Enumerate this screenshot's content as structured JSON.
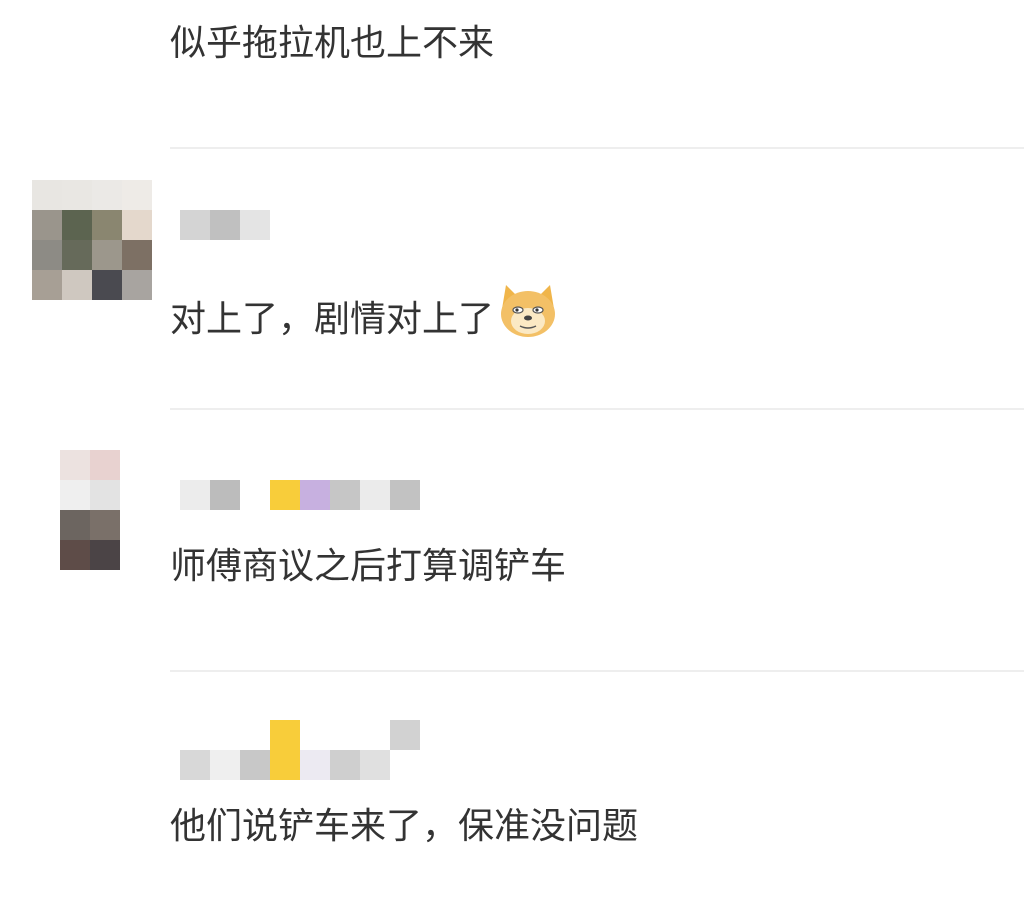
{
  "comments": [
    {
      "text": "似乎拖拉机也上不来"
    },
    {
      "text": "对上了，剧情对上了",
      "emoji": "doge-emoji"
    },
    {
      "text": "师傅商议之后打算调铲车"
    },
    {
      "text": "他们说铲车来了，保准没问题"
    }
  ],
  "colors": {
    "text": "#333333",
    "divider": "#eeeeee",
    "blur_yellow": "#f8cd3a",
    "blur_purple": "#c7b0e0"
  }
}
